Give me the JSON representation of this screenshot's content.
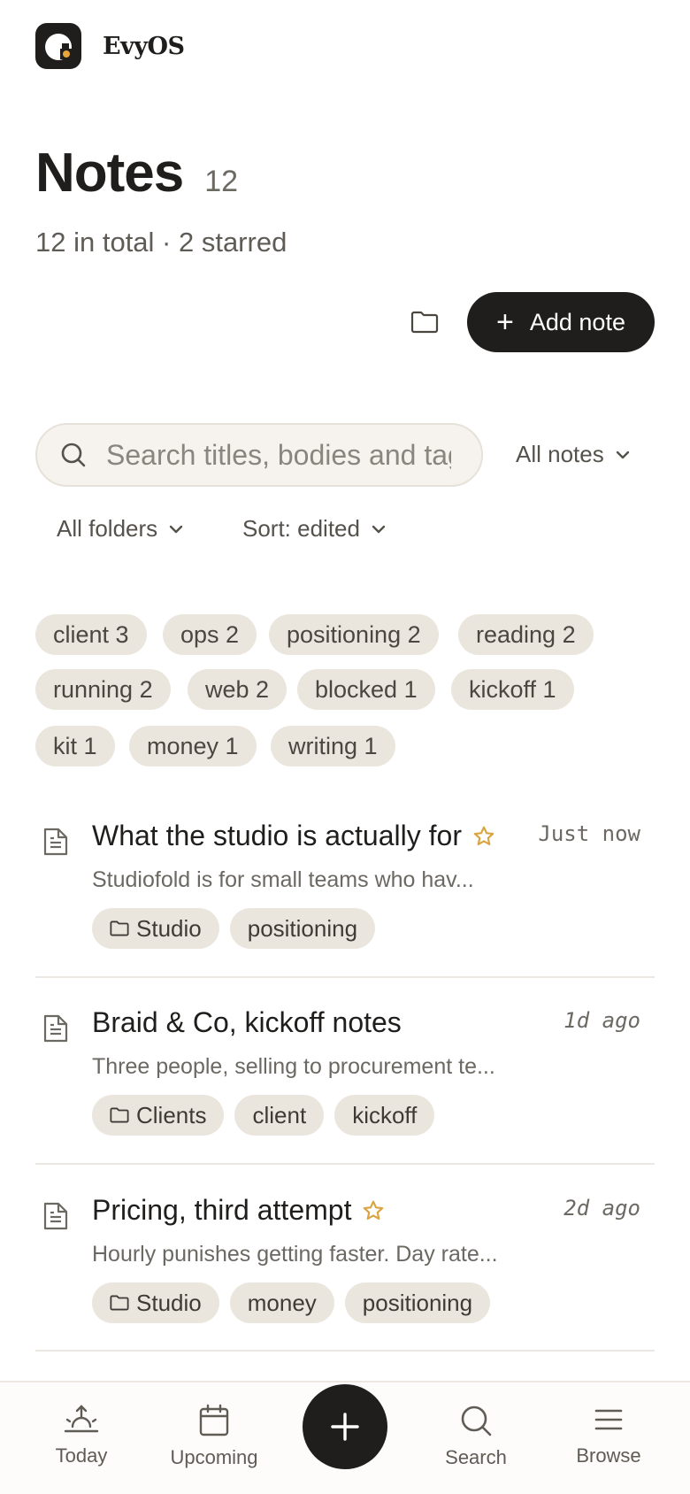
{
  "brand": {
    "name": "EvyOS",
    "logo_icon": "evy-e-logo-icon"
  },
  "header": {
    "title": "Notes",
    "count": "12",
    "subtitle": "12 in total · 2 starred"
  },
  "actions": {
    "folder_icon": "folder-icon",
    "add_note_label": "Add note"
  },
  "search": {
    "placeholder": "Search titles, bodies and tags",
    "value": ""
  },
  "filters": {
    "scope": "All notes",
    "folders": "All folders",
    "sort": "Sort: edited"
  },
  "tags": [
    {
      "label": "client 3"
    },
    {
      "label": "ops 2"
    },
    {
      "label": "positioning 2"
    },
    {
      "label": "reading 2"
    },
    {
      "label": "running 2"
    },
    {
      "label": "web 2"
    },
    {
      "label": "blocked 1"
    },
    {
      "label": "kickoff 1"
    },
    {
      "label": "kit 1"
    },
    {
      "label": "money 1"
    },
    {
      "label": "writing 1"
    }
  ],
  "notes": [
    {
      "title": "What the studio is actually for",
      "starred": true,
      "time": "Just now",
      "excerpt": "Studiofold is for small teams who hav...",
      "folder": "Studio",
      "tags": [
        "positioning"
      ]
    },
    {
      "title": "Braid & Co, kickoff notes",
      "starred": false,
      "time": "1d ago",
      "excerpt": "Three people, selling to procurement te...",
      "folder": "Clients",
      "tags": [
        "client",
        "kickoff"
      ]
    },
    {
      "title": "Pricing, third attempt",
      "starred": true,
      "time": "2d ago",
      "excerpt": "Hourly punishes getting faster. Day rate...",
      "folder": "Studio",
      "tags": [
        "money",
        "positioning"
      ]
    }
  ],
  "nav": {
    "today": "Today",
    "upcoming": "Upcoming",
    "search": "Search",
    "browse": "Browse"
  },
  "colors": {
    "ink": "#1f1e1c",
    "chip_bg": "#ebe6dd",
    "star": "#d9a441",
    "logo_dot": "#e8a53a"
  }
}
